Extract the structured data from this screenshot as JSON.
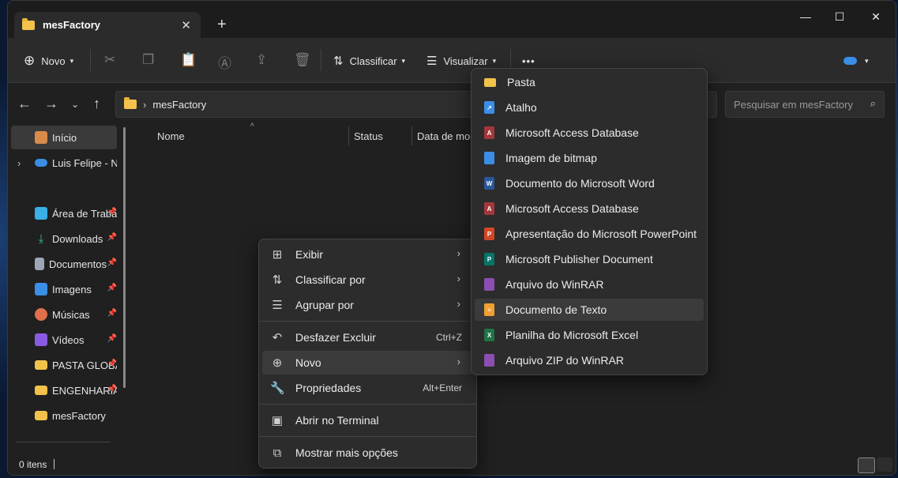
{
  "window": {
    "tab_title": "mesFactory",
    "new_tab": "+",
    "minimize": "—",
    "maximize": "☐",
    "close": "✕"
  },
  "toolbar": {
    "new_label": "Novo",
    "sort_label": "Classificar",
    "view_label": "Visualizar",
    "more_label": "•••"
  },
  "address": {
    "path": "mesFactory",
    "search_placeholder": "Pesquisar em mesFactory"
  },
  "sidebar": {
    "items": [
      {
        "label": "Início",
        "icon": "home-icon"
      },
      {
        "label": "Luis Felipe - Nev",
        "icon": "onedrive-icon"
      },
      {
        "label": "Área de Traba",
        "icon": "desktop-icon",
        "pinned": true
      },
      {
        "label": "Downloads",
        "icon": "download-icon",
        "pinned": true
      },
      {
        "label": "Documentos",
        "icon": "documents-icon",
        "pinned": true
      },
      {
        "label": "Imagens",
        "icon": "pictures-icon",
        "pinned": true
      },
      {
        "label": "Músicas",
        "icon": "music-icon",
        "pinned": true
      },
      {
        "label": "Vídeos",
        "icon": "videos-icon",
        "pinned": true
      },
      {
        "label": "PASTA GLOBA",
        "icon": "network-folder-icon",
        "pinned": true
      },
      {
        "label": "ENGENHARIA",
        "icon": "network-folder-icon",
        "pinned": true
      },
      {
        "label": "mesFactory",
        "icon": "folder-icon"
      }
    ]
  },
  "columns": {
    "name": "Nome",
    "status": "Status",
    "date": "Data de mod"
  },
  "status_bar": {
    "count": "0 itens"
  },
  "context_menu": {
    "items": [
      {
        "label": "Exibir",
        "icon": "grid-icon",
        "submenu": true
      },
      {
        "label": "Classificar por",
        "icon": "sort-icon",
        "submenu": true
      },
      {
        "label": "Agrupar por",
        "icon": "group-icon",
        "submenu": true
      },
      {
        "label": "Desfazer Excluir",
        "icon": "undo-icon",
        "shortcut": "Ctrl+Z"
      },
      {
        "label": "Novo",
        "icon": "plus-circle-icon",
        "submenu": true,
        "highlighted": true
      },
      {
        "label": "Propriedades",
        "icon": "wrench-icon",
        "shortcut": "Alt+Enter"
      },
      {
        "label": "Abrir no Terminal",
        "icon": "terminal-icon"
      },
      {
        "label": "Mostrar mais opções",
        "icon": "share-icon"
      }
    ]
  },
  "new_submenu": {
    "items": [
      {
        "label": "Pasta",
        "icon": "folder-icon",
        "color": "#f3c24b"
      },
      {
        "label": "Atalho",
        "icon": "shortcut-icon",
        "color": "#3a8ee6"
      },
      {
        "label": "Microsoft Access Database",
        "icon": "access-icon",
        "color": "#a4373a"
      },
      {
        "label": "Imagem de bitmap",
        "icon": "bitmap-icon",
        "color": "#3a8ee6"
      },
      {
        "label": "Documento do Microsoft Word",
        "icon": "word-icon",
        "color": "#2b579a"
      },
      {
        "label": "Microsoft Access Database",
        "icon": "access-icon",
        "color": "#a4373a"
      },
      {
        "label": "Apresentação do Microsoft PowerPoint",
        "icon": "powerpoint-icon",
        "color": "#d24726"
      },
      {
        "label": "Microsoft Publisher Document",
        "icon": "publisher-icon",
        "color": "#077568"
      },
      {
        "label": "Arquivo do WinRAR",
        "icon": "winrar-icon",
        "color": "#8a4fb0"
      },
      {
        "label": "Documento de Texto",
        "icon": "text-document-icon",
        "color": "#f0a030",
        "highlighted": true
      },
      {
        "label": "Planilha do Microsoft Excel",
        "icon": "excel-icon",
        "color": "#217346"
      },
      {
        "label": "Arquivo ZIP do WinRAR",
        "icon": "winrar-zip-icon",
        "color": "#8a4fb0"
      }
    ]
  }
}
